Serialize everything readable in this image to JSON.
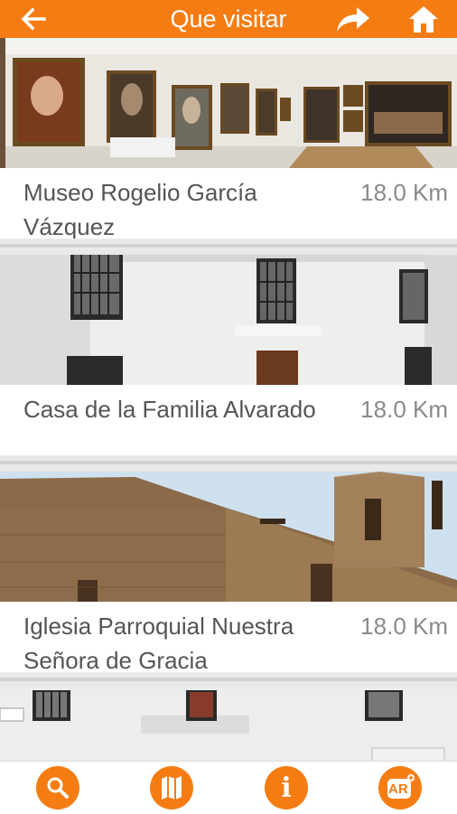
{
  "header": {
    "title": "Que visitar",
    "back_icon": "arrow-left-icon",
    "share_icon": "share-arrow-icon",
    "home_icon": "home-icon"
  },
  "places": [
    {
      "name": "Museo Rogelio García Vázquez",
      "distance": "18.0 Km",
      "image": "museum-gallery-photo"
    },
    {
      "name": "Casa de la Familia Alvarado",
      "distance": "18.0 Km",
      "image": "white-house-facade-photo"
    },
    {
      "name": "Iglesia Parroquial Nuestra Señora de Gracia",
      "distance": "18.0 Km",
      "image": "stone-church-photo"
    },
    {
      "name": "",
      "distance": "",
      "image": "white-building-photo"
    }
  ],
  "bottom_nav": {
    "search_icon": "search-icon",
    "map_icon": "map-icon",
    "info_icon": "info-icon",
    "info_glyph": "i",
    "ar_icon": "ar-icon",
    "ar_label": "AR"
  },
  "colors": {
    "accent": "#f57c12",
    "text": "#555555",
    "distance": "#8a8a8a"
  }
}
